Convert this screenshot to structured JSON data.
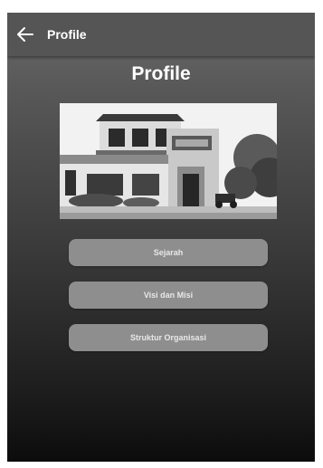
{
  "appbar": {
    "back_icon": "arrow-left-icon",
    "title": "Profile"
  },
  "header": {
    "title": "Profile"
  },
  "menu": {
    "items": [
      {
        "label": "Sejarah"
      },
      {
        "label": "Visi dan Misi"
      },
      {
        "label": "Struktur Organisasi"
      }
    ]
  },
  "colors": {
    "appbar": "#555555",
    "button": "#8e8e8e",
    "text": "#ffffff"
  }
}
